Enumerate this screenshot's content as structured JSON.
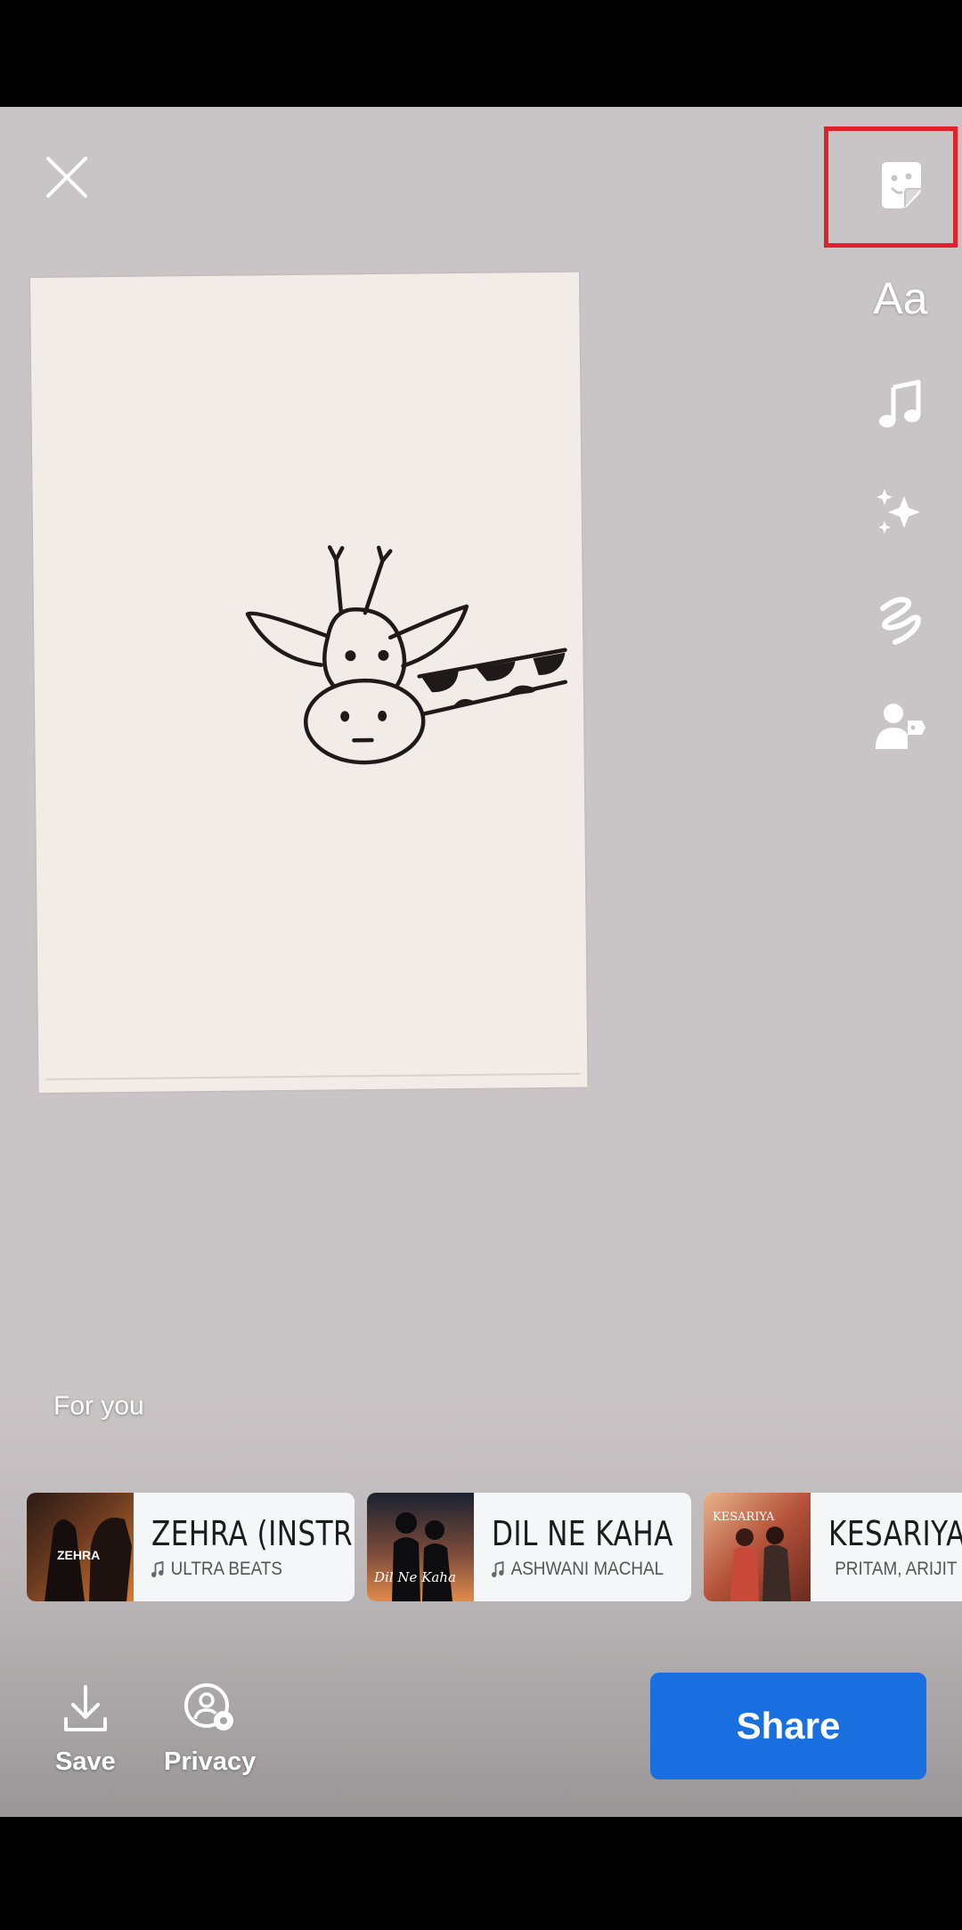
{
  "stickers_tool_icon": "sticker-icon",
  "text_tool": {
    "label": "Aa"
  },
  "tools": [
    "sticker-icon",
    "text-icon",
    "music-icon",
    "effects-icon",
    "draw-icon",
    "tag-people-icon"
  ],
  "section_title": "For you",
  "music": [
    {
      "title": "ZEHRA (INSTRUMENTAL)",
      "artist": "ULTRA BEATS",
      "thumb_text": "ZEHRA"
    },
    {
      "title": "DIL NE KAHA",
      "artist": "ASHWANI MACHAL",
      "thumb_text": "Dil Ne Kaha"
    },
    {
      "title": "KESARIYA",
      "artist": "PRITAM, ARIJIT SINGH",
      "thumb_text": "KESARIYA"
    }
  ],
  "bottom": {
    "save_label": "Save",
    "privacy_label": "Privacy",
    "share_label": "Share"
  },
  "colors": {
    "share": "#1a6fe0",
    "highlight": "#e1202b"
  }
}
